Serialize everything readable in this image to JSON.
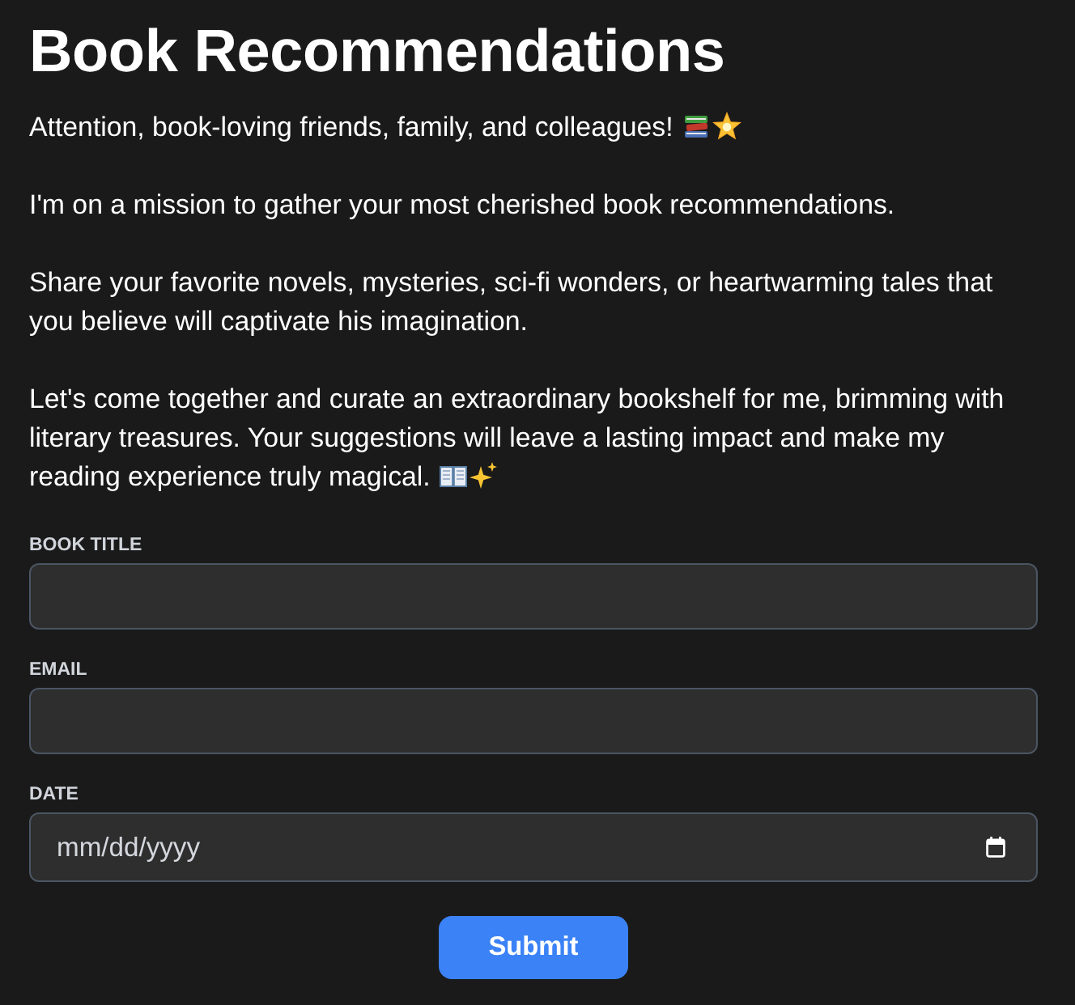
{
  "title": "Book Recommendations",
  "paragraphs": [
    "Attention, book-loving friends, family, and colleagues!",
    "I'm on a mission to gather your most cherished book recommendations.",
    "Share your favorite novels, mysteries, sci-fi wonders, or heartwarming tales that you believe will captivate his imagination.",
    "Let's come together and curate an extraordinary bookshelf for me, brimming with literary treasures. Your suggestions will leave a lasting impact and make my reading experience truly magical."
  ],
  "fields": [
    {
      "kind": "text",
      "label": "BOOK TITLE"
    },
    {
      "kind": "email",
      "label": "EMAIL"
    },
    {
      "kind": "date",
      "label": "DATE",
      "placeholder": "mm/dd/yyyy"
    }
  ],
  "submit": {
    "label": "Submit"
  }
}
